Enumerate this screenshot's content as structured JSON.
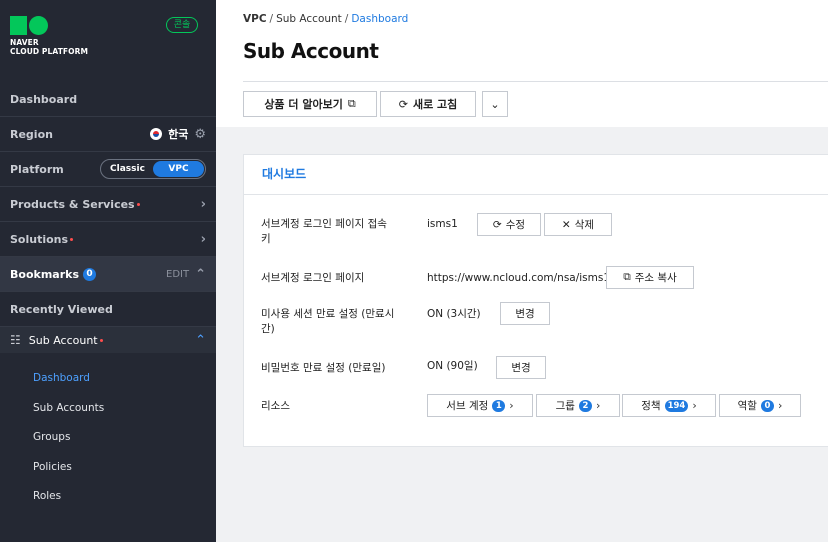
{
  "sidebar": {
    "logo_line1": "NAVER",
    "logo_line2": "CLOUD PLATFORM",
    "console_badge": "콘솔",
    "dashboard": "Dashboard",
    "region_label": "Region",
    "region_value": "한국",
    "platform_label": "Platform",
    "platform_options": [
      "Classic",
      "VPC"
    ],
    "platform_selected": "VPC",
    "products": "Products & Services",
    "solutions": "Solutions",
    "bookmarks": "Bookmarks",
    "bookmarks_count": "0",
    "edit": "EDIT",
    "recently_viewed": "Recently Viewed",
    "sub_account": "Sub Account",
    "sub_items": [
      "Dashboard",
      "Sub Accounts",
      "Groups",
      "Policies",
      "Roles"
    ],
    "active_sub_item": "Dashboard"
  },
  "breadcrumb": {
    "root": "VPC",
    "mid": "Sub Account",
    "current": "Dashboard"
  },
  "page_title": "Sub Account",
  "toolbar": {
    "learn_more": "상품 더 알아보기",
    "refresh": "새로 고침"
  },
  "card": {
    "title": "대시보드",
    "login_key_label_1": "서브계정 로그인 페이지 접속",
    "login_key_label_2": "키",
    "login_key_value": "isms1",
    "edit_btn": "수정",
    "delete_btn": "삭제",
    "login_page_label": "서브계정 로그인 페이지",
    "login_page_value": "https://www.ncloud.com/nsa/isms1",
    "copy_btn": "주소 복사",
    "session_label_1": "미사용 세션 만료 설정 (만료시",
    "session_label_2": "간)",
    "session_value": "ON (3시간)",
    "change_btn": "변경",
    "password_label": "비밀번호 만료 설정 (만료일)",
    "password_value": "ON (90일)",
    "resource_label": "리소스",
    "resources": [
      {
        "label": "서브 계정",
        "count": "1"
      },
      {
        "label": "그룹",
        "count": "2"
      },
      {
        "label": "정책",
        "count": "194"
      },
      {
        "label": "역할",
        "count": "0"
      }
    ]
  },
  "colors": {
    "sidebar_bg": "#242833",
    "accent": "#1f7ae0",
    "brand_green": "#03c75a"
  }
}
